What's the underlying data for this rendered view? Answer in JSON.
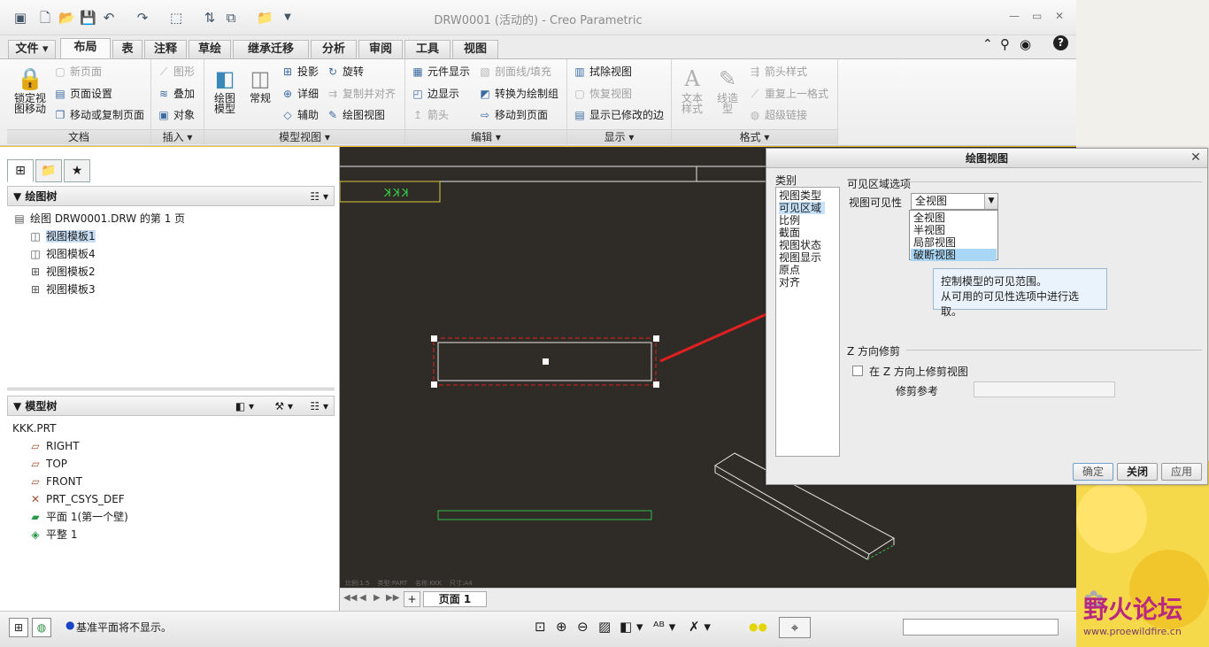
{
  "window": {
    "title": "DRW0001 (活动的) - Creo Parametric"
  },
  "tabs": [
    "文件",
    "布局",
    "表",
    "注释",
    "草绘",
    "继承迁移",
    "分析",
    "审阅",
    "工具",
    "视图"
  ],
  "ribbon": {
    "doc": {
      "label": "文档",
      "lock": "锁定视图移动",
      "new_page": "新页面",
      "page_setup": "页面设置",
      "move_copy": "移动或复制页面"
    },
    "insert": {
      "label": "插入",
      "graph": "图形",
      "overlay": "叠加",
      "object": "对象"
    },
    "model_views": {
      "label": "模型视图",
      "drawing_model": "绘图模型",
      "general": "常规",
      "projection": "投影",
      "detail": "详细",
      "auxiliary": "辅助",
      "rotate": "旋转",
      "copy_align": "复制并对齐",
      "drawing_view": "绘图视图"
    },
    "edit": {
      "label": "编辑",
      "elem_display": "元件显示",
      "edge_display": "边显示",
      "arrow": "箭头",
      "xhatch": "剖面线/填充",
      "convert": "转换为绘制组",
      "move_page": "移动到页面"
    },
    "display": {
      "label": "显示",
      "erase": "拭除视图",
      "restore": "恢复视图",
      "show_modified": "显示已修改的边"
    },
    "format": {
      "label": "格式",
      "text_style": "文本样式",
      "line_style": "线造型",
      "arrow_style": "箭头样式",
      "repeat": "重复上一格式",
      "hyperlink": "超级链接"
    }
  },
  "drawing_tree": {
    "header": "绘图树",
    "root": "绘图 DRW0001.DRW 的第 1 页",
    "items": [
      "视图模板1",
      "视图模板4",
      "视图模板2",
      "视图模板3"
    ]
  },
  "model_tree": {
    "header": "模型树",
    "root": "KKK.PRT",
    "items": [
      "RIGHT",
      "TOP",
      "FRONT",
      "PRT_CSYS_DEF",
      "平面 1(第一个壁)",
      "平整 1"
    ]
  },
  "canvas": {
    "label": "KKK",
    "footer": "比例:1:5    类型:PART    名称:KKK    尺寸:A4"
  },
  "page_nav": {
    "add": "+",
    "page": "页面 1"
  },
  "status": {
    "message": "基准平面将不显示。"
  },
  "watermark": {
    "text": "野火论坛",
    "url": "www.proewildfire.cn"
  },
  "dialog": {
    "title": "绘图视图",
    "categories_label": "类别",
    "categories": [
      "视图类型",
      "可见区域",
      "比例",
      "截面",
      "视图状态",
      "视图显示",
      "原点",
      "对齐"
    ],
    "section_visible": "可见区域选项",
    "visibility_label": "视图可见性",
    "visibility_value": "全视图",
    "visibility_options": [
      "全视图",
      "半视图",
      "局部视图",
      "破断视图"
    ],
    "tooltip": [
      "控制模型的可见范围。",
      "从可用的可见性选项中进行选取。"
    ],
    "section_z": "Z 方向修剪",
    "z_checkbox": "在 Z 方向上修剪视图",
    "trim_ref": "修剪参考",
    "buttons": {
      "ok": "确定",
      "close": "关闭",
      "apply": "应用"
    }
  },
  "colors": {
    "canvas_bg": "#2f2c28",
    "arrow": "#e02020",
    "selection": "#c6e2fa",
    "frame": "#d9c83a"
  }
}
